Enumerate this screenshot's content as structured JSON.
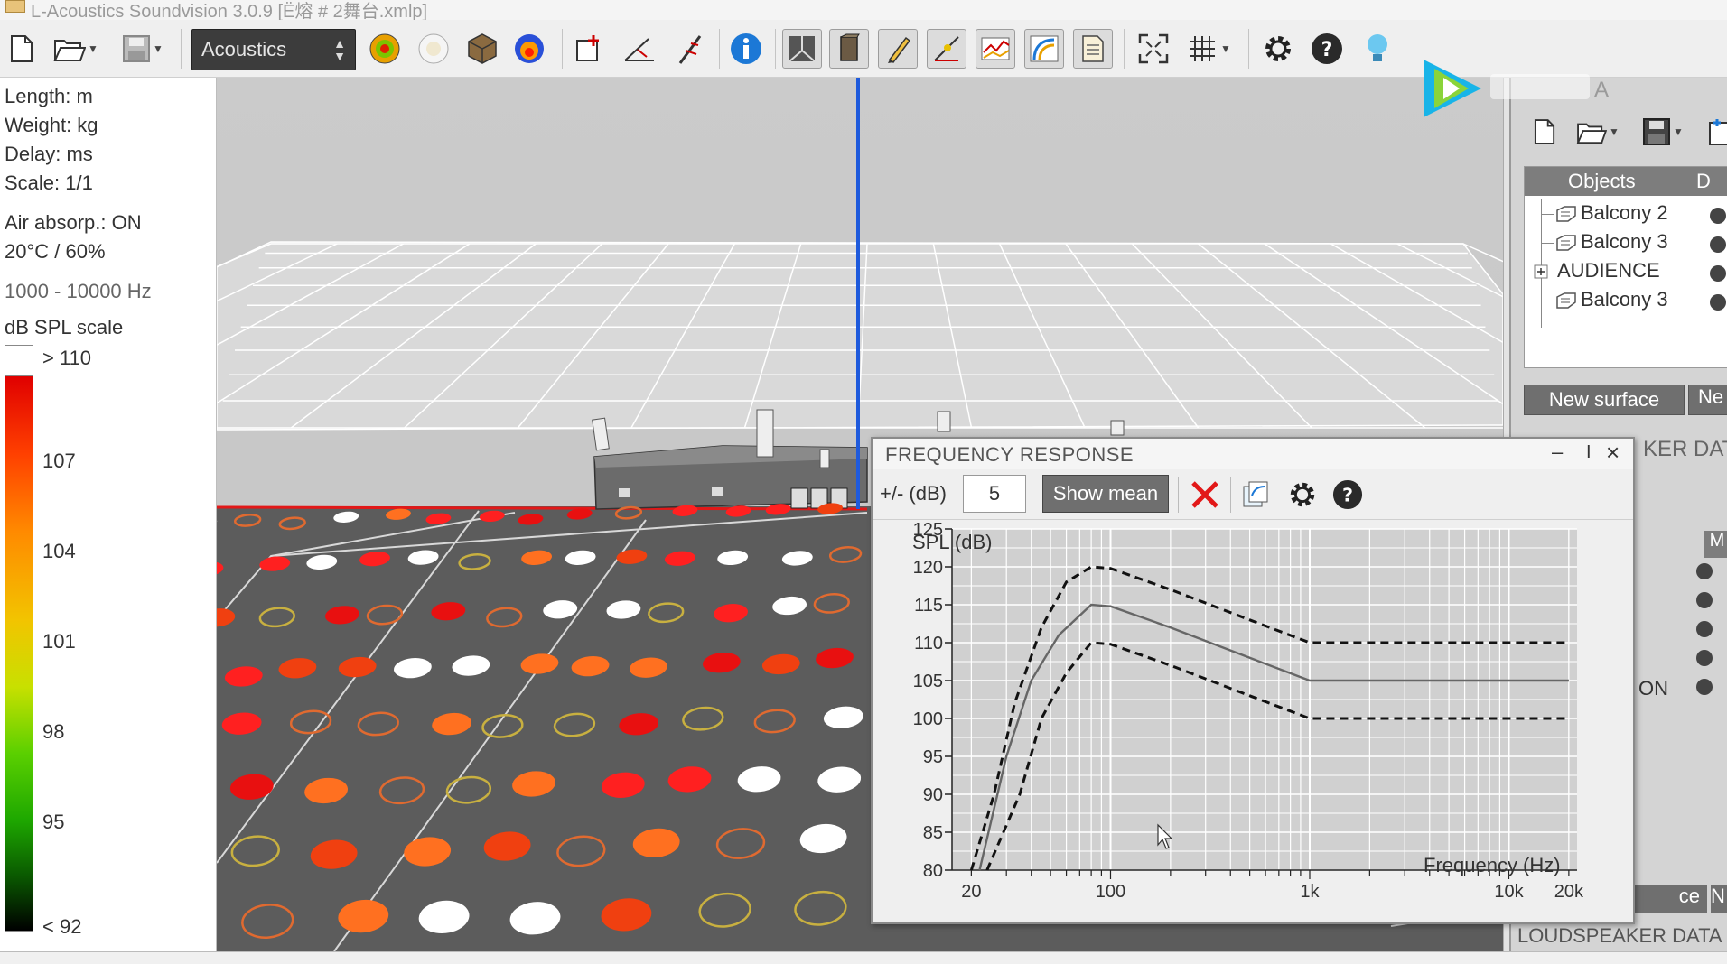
{
  "window": {
    "title": "L-Acoustics Soundvision 3.0.9 [Ё熔 # 2舞台.xmlp]"
  },
  "toolbar": {
    "mode_select": "Acoustics"
  },
  "info_panel": {
    "length": "Length: m",
    "weight": "Weight: kg",
    "delay": "Delay: ms",
    "scale": "Scale: 1/1",
    "air_absorption": "Air absorp.: ON",
    "conditions": "20°C / 60%",
    "band": "1000 - 10000 Hz",
    "spl_title": "dB SPL scale",
    "spl_levels": [
      "> 110",
      "107",
      "104",
      "101",
      "98",
      "95",
      "< 92"
    ]
  },
  "objects_panel": {
    "title_fragment": "A",
    "header_objects": "Objects",
    "header_d": "D",
    "items": [
      {
        "label": "Balcony 2"
      },
      {
        "label": "Balcony 3"
      },
      {
        "label": "AUDIENCE"
      },
      {
        "label": "Balcony 3"
      }
    ],
    "new_surface_button": "New surface",
    "new_button_fragment": "Ne",
    "speaker_data_fragment": "KER DAT",
    "m_column": "M",
    "on_fragment": "ON",
    "ce_button_fragment": "ce",
    "ne_button2_fragment": "N",
    "loudspeaker_data": "LOUDSPEAKER DATA"
  },
  "frequency_response": {
    "title": "FREQUENCY RESPONSE",
    "tolerance_label": "+/- (dB)",
    "tolerance_value": "5",
    "show_mean_button": "Show mean",
    "minimize": "–",
    "pin": "I",
    "close": "×"
  },
  "colors": {
    "viewport_bg": "#c9c9c9",
    "floor": "#5c5c5c",
    "accent_red": "#e21818",
    "axis_blue": "#1e5adc"
  },
  "chart_data": {
    "type": "line",
    "ylabel": "SPL (dB)",
    "xlabel": "Frequency (Hz)",
    "xscale": "log",
    "xlim": [
      16,
      22000
    ],
    "ylim": [
      80,
      125
    ],
    "yticks": [
      80,
      85,
      90,
      95,
      100,
      105,
      110,
      115,
      120,
      125
    ],
    "xticks": [
      {
        "v": 20,
        "label": "20"
      },
      {
        "v": 100,
        "label": "100"
      },
      {
        "v": 1000,
        "label": "1k"
      },
      {
        "v": 10000,
        "label": "10k"
      },
      {
        "v": 20000,
        "label": "20k"
      }
    ],
    "grid": true,
    "series": [
      {
        "style": "solid",
        "points": [
          [
            22,
            80
          ],
          [
            30,
            95
          ],
          [
            40,
            105
          ],
          [
            55,
            111
          ],
          [
            80,
            115
          ],
          [
            100,
            114.8
          ],
          [
            200,
            112
          ],
          [
            500,
            108
          ],
          [
            1000,
            105
          ],
          [
            20000,
            105
          ]
        ]
      },
      {
        "style": "dashed",
        "points": [
          [
            20,
            80
          ],
          [
            26,
            90
          ],
          [
            33,
            102
          ],
          [
            45,
            112
          ],
          [
            60,
            118
          ],
          [
            80,
            120
          ],
          [
            100,
            119.8
          ],
          [
            200,
            117
          ],
          [
            500,
            113
          ],
          [
            1000,
            110
          ],
          [
            20000,
            110
          ]
        ]
      },
      {
        "style": "dashed",
        "points": [
          [
            24,
            80
          ],
          [
            35,
            90
          ],
          [
            45,
            100
          ],
          [
            60,
            106
          ],
          [
            80,
            110
          ],
          [
            100,
            109.8
          ],
          [
            200,
            107
          ],
          [
            500,
            103
          ],
          [
            1000,
            100
          ],
          [
            20000,
            100
          ]
        ]
      }
    ]
  }
}
